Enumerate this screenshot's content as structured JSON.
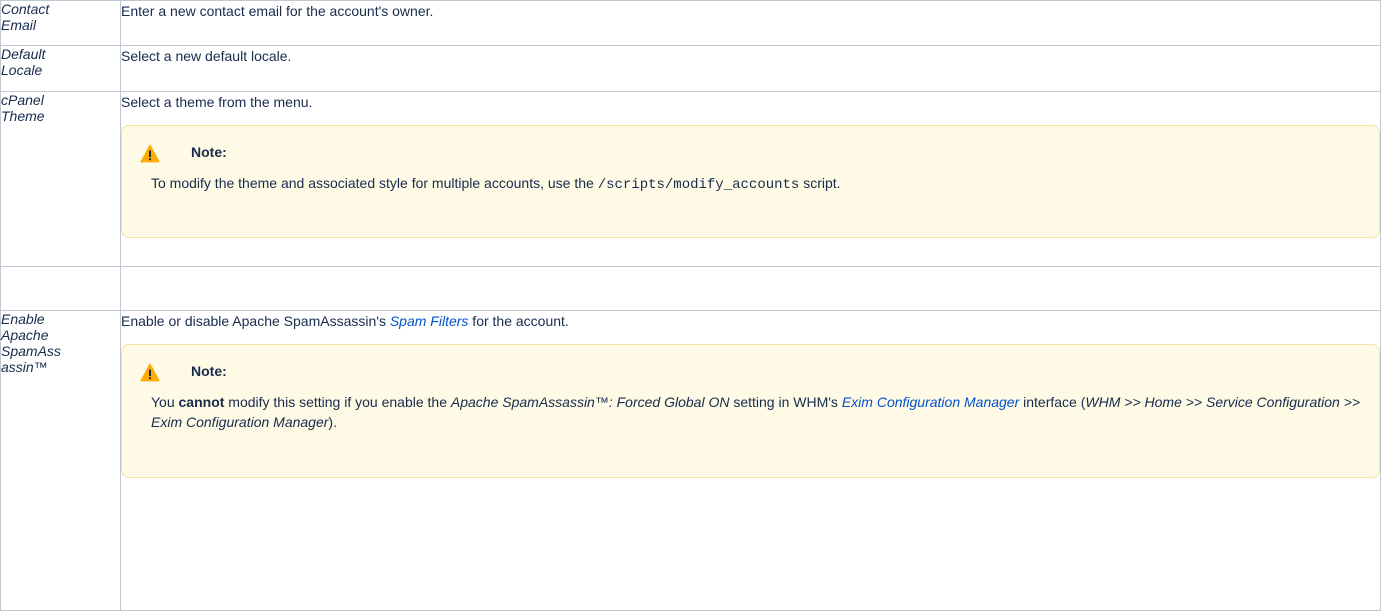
{
  "rows": {
    "contact_email": {
      "label_1": "Contact",
      "label_2": "Email",
      "desc": "Enter a new contact email for the account's owner."
    },
    "default_locale": {
      "label_1": "Default",
      "label_2": "Locale",
      "desc": "Select a new default locale."
    },
    "cpanel_theme": {
      "label_1": "cPanel",
      "label_2": "Theme",
      "desc": "Select a theme from the menu.",
      "note_title": "Note:",
      "note_text_1": "To modify the theme and associated style for multiple accounts, use the ",
      "note_code": "/scripts/modify_accounts",
      "note_text_2": " script."
    },
    "spamassassin": {
      "label_1": "Enable",
      "label_2": "Apache",
      "label_3": "SpamAss",
      "label_4": "assin™",
      "desc_1": "Enable or disable Apache SpamAssassin's ",
      "desc_link": "Spam Filters",
      "desc_2": " for the account.",
      "note_title": "Note:",
      "note_t1": "You ",
      "note_bold": "cannot",
      "note_t2": " modify this setting if you enable the ",
      "note_em1": "Apache SpamAssassin™: Forced Global ON",
      "note_t3": " setting in WHM's ",
      "note_link": "Exim Configuration Manager",
      "note_t4": " interface (",
      "note_em2": "WHM >> Home >> Service Configuration >> Exim Configuration Manager",
      "note_t5": ")."
    }
  },
  "icons": {
    "warning": "warning-icon"
  },
  "colors": {
    "link": "#0052cc",
    "note_background": "#fffae6",
    "note_border": "#f4e3a3",
    "warning_fill": "#ffab00"
  }
}
